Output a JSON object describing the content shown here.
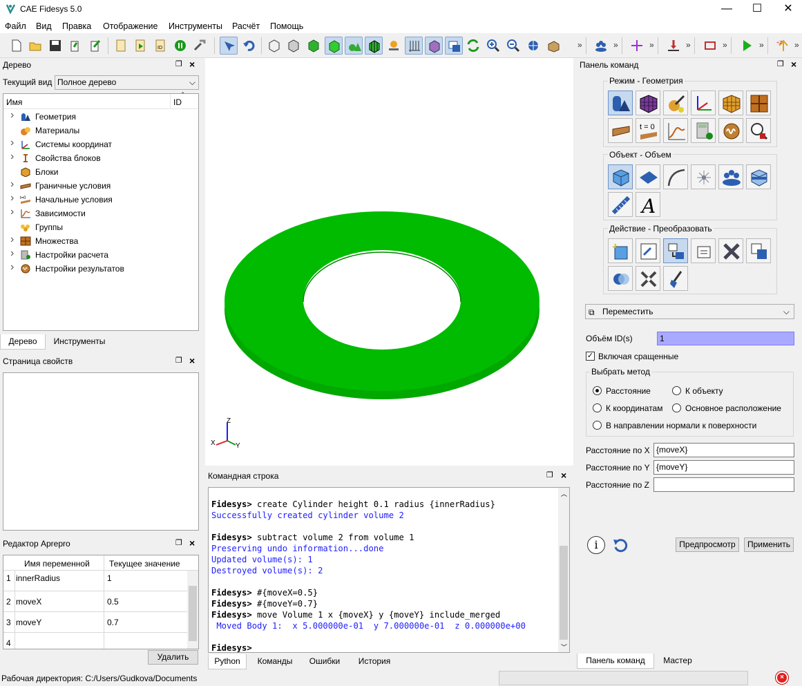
{
  "window": {
    "title": "CAE Fidesys 5.0",
    "min": "—",
    "max": "☐",
    "close": "✕"
  },
  "menu": [
    "Файл",
    "Вид",
    "Правка",
    "Отображение",
    "Инструменты",
    "Расчёт",
    "Помощь"
  ],
  "tree_panel": {
    "title": "Дерево",
    "view_label": "Текущий вид",
    "view_value": "Полное дерево",
    "col_name": "Имя",
    "col_id": "ID",
    "items": [
      {
        "label": "Геометрия",
        "icon": "geometry-icon",
        "expandable": true
      },
      {
        "label": "Материалы",
        "icon": "materials-icon",
        "expandable": false
      },
      {
        "label": "Системы координат",
        "icon": "coordinate-systems-icon",
        "expandable": true
      },
      {
        "label": "Свойства блоков",
        "icon": "block-properties-icon",
        "expandable": true
      },
      {
        "label": "Блоки",
        "icon": "blocks-icon",
        "expandable": false
      },
      {
        "label": "Граничные условия",
        "icon": "boundary-conditions-icon",
        "expandable": true
      },
      {
        "label": "Начальные условия",
        "icon": "initial-conditions-icon",
        "expandable": true
      },
      {
        "label": "Зависимости",
        "icon": "dependencies-icon",
        "expandable": true
      },
      {
        "label": "Группы",
        "icon": "groups-icon",
        "expandable": false
      },
      {
        "label": "Множества",
        "icon": "sets-icon",
        "expandable": true
      },
      {
        "label": "Настройки расчета",
        "icon": "calc-settings-icon",
        "expandable": true
      },
      {
        "label": "Настройки результатов",
        "icon": "results-settings-icon",
        "expandable": true
      }
    ],
    "tabs": [
      "Дерево",
      "Инструменты"
    ]
  },
  "properties_panel": {
    "title": "Страница свойств"
  },
  "aprepro": {
    "title": "Редактор Aprepro",
    "col_name": "Имя переменной",
    "col_value": "Текущее значение",
    "rows": [
      {
        "n": "1",
        "name": "innerRadius",
        "value": "1"
      },
      {
        "n": "2",
        "name": "moveX",
        "value": "0.5"
      },
      {
        "n": "3",
        "name": "moveY",
        "value": "0.7"
      },
      {
        "n": "4",
        "name": "",
        "value": ""
      }
    ],
    "delete_label": "Удалить"
  },
  "status": {
    "workdir": "Рабочая директория: C:/Users/Gudkova/Documents"
  },
  "axes": {
    "x": "X",
    "y": "Y",
    "z": "Z"
  },
  "command_panel": {
    "title": "Командная строка",
    "lines": [
      {
        "k": "p",
        "t": ""
      },
      {
        "k": "p",
        "t": "Fidesys> create Cylinder height 0.1 radius {innerRadius}"
      },
      {
        "k": "o",
        "t": "Successfully created cylinder volume 2"
      },
      {
        "k": "p",
        "t": ""
      },
      {
        "k": "p",
        "t": "Fidesys> subtract volume 2 from volume 1"
      },
      {
        "k": "o",
        "t": "Preserving undo information...done"
      },
      {
        "k": "o",
        "t": "Updated volume(s): 1"
      },
      {
        "k": "o",
        "t": "Destroyed volume(s): 2"
      },
      {
        "k": "p",
        "t": ""
      },
      {
        "k": "p",
        "t": "Fidesys> #{moveX=0.5}"
      },
      {
        "k": "p",
        "t": "Fidesys> #{moveY=0.7}"
      },
      {
        "k": "p",
        "t": "Fidesys> move Volume 1 x {moveX} y {moveY} include_merged"
      },
      {
        "k": "o",
        "t": " Moved Body 1:  x 5.000000e-01  y 7.000000e-01  z 0.000000e+00"
      },
      {
        "k": "p",
        "t": ""
      },
      {
        "k": "p",
        "t": "Fidesys> "
      }
    ],
    "tabs": [
      "Python",
      "Команды",
      "Ошибки",
      "История"
    ]
  },
  "right_panel": {
    "title": "Панель команд",
    "mode_label": "Режим - Геометрия",
    "object_label": "Объект - Объем",
    "action_label": "Действие - Преобразовать",
    "operation": "Переместить",
    "volume_ids_label": "Объём ID(s)",
    "volume_ids_value": "1",
    "include_merged": "Включая сращенные",
    "method_label": "Выбрать метод",
    "methods": [
      "Расстояние",
      "К объекту",
      "К координатам",
      "Основное расположение",
      "В направлении нормали к поверхности"
    ],
    "dist_x_label": "Расстояние по X",
    "dist_x_value": "{moveX}",
    "dist_y_label": "Расстояние по Y",
    "dist_y_value": "{moveY}",
    "dist_z_label": "Расстояние по Z",
    "dist_z_value": "",
    "preview": "Предпросмотр",
    "apply": "Применить",
    "tabs": [
      "Панель команд",
      "Мастер"
    ]
  },
  "colors": {
    "model": "#00bb00",
    "accent": "#3366cc",
    "output": "#2020ff"
  }
}
